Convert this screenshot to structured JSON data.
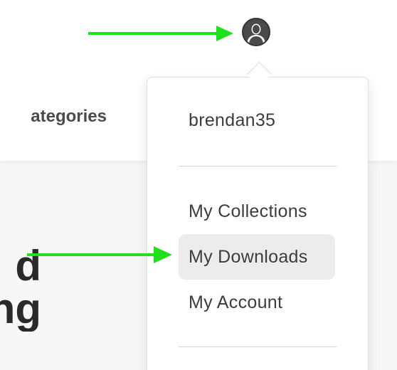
{
  "header": {
    "nav_visible_text": "ategories"
  },
  "hero": {
    "line_1": "d",
    "line_2": "ng"
  },
  "user_menu": {
    "username": "brendan35",
    "items": [
      {
        "label": "My Collections",
        "highlighted": false
      },
      {
        "label": "My Downloads",
        "highlighted": true
      },
      {
        "label": "My Account",
        "highlighted": false
      }
    ]
  },
  "icons": {
    "avatar": "user-avatar-icon",
    "annotation": "arrow-right-icon"
  },
  "colors": {
    "annotation_green": "#1ee01e",
    "highlight_bg": "#ececec",
    "text_dark": "#3c3c3c"
  }
}
